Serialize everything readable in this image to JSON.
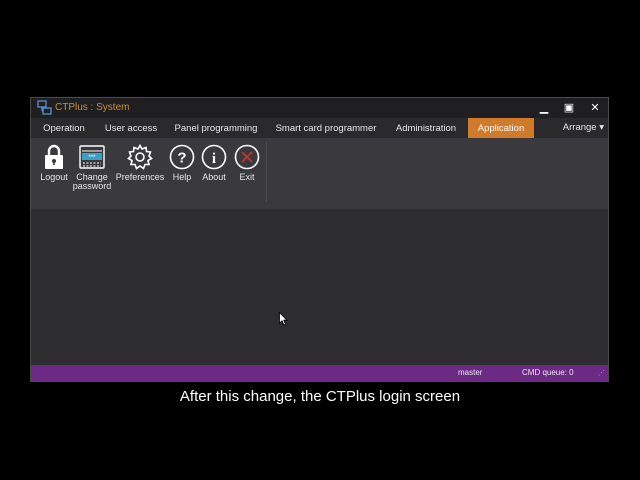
{
  "window": {
    "title": "CTPlus : System",
    "minimize_label": "▁",
    "maximize_label": "▣",
    "close_label": "✕"
  },
  "menu": {
    "tabs": [
      {
        "label": "Operation"
      },
      {
        "label": "User access"
      },
      {
        "label": "Panel programming"
      },
      {
        "label": "Smart card programmer"
      },
      {
        "label": "Administration"
      },
      {
        "label": "Application",
        "active": true
      }
    ],
    "arrange_label": "Arrange ▾"
  },
  "ribbon": {
    "buttons": [
      {
        "label": "Logout",
        "icon": "lock-icon"
      },
      {
        "label": "Change\npassword",
        "icon": "password-keyboard-icon"
      },
      {
        "label": "Preferences",
        "icon": "gear-icon"
      },
      {
        "label": "Help",
        "icon": "question-icon"
      },
      {
        "label": "About",
        "icon": "info-icon"
      },
      {
        "label": "Exit",
        "icon": "exit-icon"
      }
    ]
  },
  "status": {
    "user": "master",
    "cmd_queue": "CMD queue: 0"
  },
  "caption": "After this change, the CTPlus login screen",
  "colors": {
    "accent_tab": "#d07a2a",
    "status_bar": "#6c2a85",
    "title_text": "#c98a3c",
    "exit_red": "#c0392b"
  }
}
